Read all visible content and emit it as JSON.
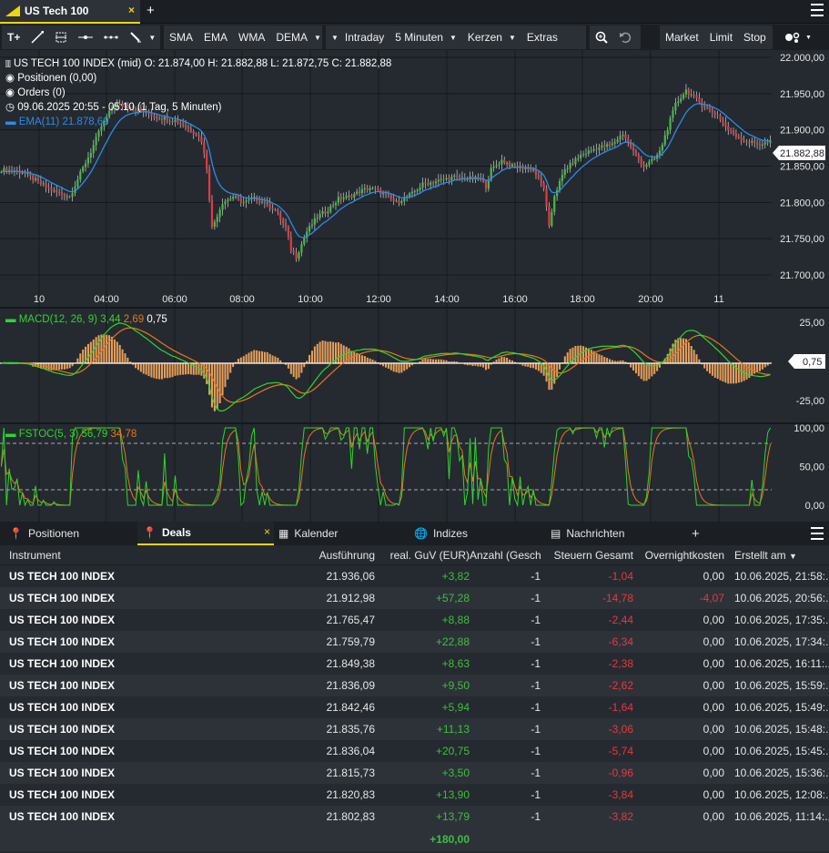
{
  "tab": {
    "title": "US Tech 100",
    "close": "×",
    "add": "+"
  },
  "toolbar": {
    "text_tool": "T+",
    "indicators": [
      "SMA",
      "EMA",
      "WMA",
      "DEMA"
    ],
    "period": "Intraday",
    "interval": "5 Minuten",
    "style": "Kerzen",
    "extras": "Extras",
    "orders": [
      "Market",
      "Limit",
      "Stop"
    ]
  },
  "chart_data": [
    {
      "type": "candlestick",
      "title": "US TECH 100 INDEX (mid)",
      "ohlc_label": "O: 21.874,00  H: 21.882,88  L: 21.872,75  C: 21.882,88",
      "legend": [
        "Positionen (0,00)",
        "Orders (0)",
        "09.06.2025 20:55 - 05:10  (1 Tag, 5 Minuten)"
      ],
      "ema_label": "EMA(11)",
      "ema_value": "21.878,69",
      "last_price": "21.882,88",
      "ylim": [
        21680,
        22010
      ],
      "y_ticks": [
        "22.000,00",
        "21.950,00",
        "21.900,00",
        "21.850,00",
        "21.800,00",
        "21.750,00",
        "21.700,00"
      ],
      "x_ticks": [
        "10",
        "04:00",
        "06:00",
        "08:00",
        "10:00",
        "12:00",
        "14:00",
        "16:00",
        "18:00",
        "20:00",
        "11"
      ],
      "close_path": [
        [
          0,
          21845
        ],
        [
          8,
          21842
        ],
        [
          14,
          21828
        ],
        [
          20,
          21815
        ],
        [
          26,
          21808
        ],
        [
          30,
          21840
        ],
        [
          34,
          21870
        ],
        [
          38,
          21905
        ],
        [
          42,
          21930
        ],
        [
          44,
          21935
        ],
        [
          48,
          21932
        ],
        [
          54,
          21925
        ],
        [
          60,
          21917
        ],
        [
          66,
          21913
        ],
        [
          70,
          21905
        ],
        [
          72,
          21900
        ],
        [
          74,
          21895
        ],
        [
          76,
          21885
        ],
        [
          78,
          21848
        ],
        [
          80,
          21765
        ],
        [
          84,
          21800
        ],
        [
          88,
          21808
        ],
        [
          92,
          21800
        ],
        [
          96,
          21805
        ],
        [
          100,
          21800
        ],
        [
          104,
          21790
        ],
        [
          108,
          21765
        ],
        [
          110,
          21735
        ],
        [
          112,
          21725
        ],
        [
          116,
          21760
        ],
        [
          120,
          21780
        ],
        [
          124,
          21790
        ],
        [
          128,
          21805
        ],
        [
          132,
          21808
        ],
        [
          136,
          21815
        ],
        [
          140,
          21820
        ],
        [
          144,
          21814
        ],
        [
          150,
          21800
        ],
        [
          156,
          21812
        ],
        [
          160,
          21825
        ],
        [
          166,
          21830
        ],
        [
          172,
          21835
        ],
        [
          178,
          21833
        ],
        [
          182,
          21832
        ],
        [
          184,
          21822
        ],
        [
          186,
          21845
        ],
        [
          190,
          21858
        ],
        [
          194,
          21850
        ],
        [
          198,
          21848
        ],
        [
          202,
          21845
        ],
        [
          206,
          21820
        ],
        [
          208,
          21765
        ],
        [
          210,
          21810
        ],
        [
          214,
          21845
        ],
        [
          220,
          21865
        ],
        [
          226,
          21875
        ],
        [
          232,
          21880
        ],
        [
          236,
          21895
        ],
        [
          240,
          21870
        ],
        [
          244,
          21850
        ],
        [
          248,
          21860
        ],
        [
          250,
          21870
        ],
        [
          256,
          21935
        ],
        [
          260,
          21955
        ],
        [
          266,
          21935
        ],
        [
          272,
          21920
        ],
        [
          276,
          21900
        ],
        [
          282,
          21885
        ],
        [
          288,
          21880
        ],
        [
          292,
          21883
        ]
      ]
    },
    {
      "type": "line",
      "title": "MACD(12, 26, 9)",
      "values": [
        "3,44",
        "2,69",
        "0,75"
      ],
      "last_value": "0,75",
      "y_ticks": [
        "25,00",
        "-25,00"
      ]
    },
    {
      "type": "line",
      "title": "FSTOC(5, 3)",
      "values": [
        "56,79",
        "34,78"
      ],
      "y_ticks": [
        "100,00",
        "50,00",
        "0,00"
      ]
    }
  ],
  "colors": {
    "bull": "#3fbf3f",
    "bear": "#e8383d",
    "ema": "#2b8be8",
    "macd": "#2ed62e",
    "signal": "#e8771a",
    "accent": "#f2d20a"
  },
  "panel": {
    "tabs": [
      {
        "label": "Positionen",
        "icon": "pin-icon"
      },
      {
        "label": "Deals",
        "icon": "pin-icon"
      },
      {
        "label": "Kalender",
        "icon": "calendar-icon"
      },
      {
        "label": "Indizes",
        "icon": "globe-icon"
      },
      {
        "label": "Nachrichten",
        "icon": "news-icon"
      }
    ],
    "deals_close": "×",
    "add": "+"
  },
  "table": {
    "headers": [
      "Instrument",
      "Ausführung",
      "real. GuV (EUR)",
      "Anzahl (Geschl",
      "Steuern Gesamt",
      "Overnightkosten",
      "Erstellt am"
    ],
    "sort_mark": "▼",
    "rows": [
      [
        "US TECH 100 INDEX",
        "21.936,06",
        "+3,82",
        "-1",
        "-1,04",
        "0,00",
        "10.06.2025, 21:58:..."
      ],
      [
        "US TECH 100 INDEX",
        "21.912,98",
        "+57,28",
        "-1",
        "-14,78",
        "-4,07",
        "10.06.2025, 20:56:..."
      ],
      [
        "US TECH 100 INDEX",
        "21.765,47",
        "+8,88",
        "-1",
        "-2,44",
        "0,00",
        "10.06.2025, 17:35:..."
      ],
      [
        "US TECH 100 INDEX",
        "21.759,79",
        "+22,88",
        "-1",
        "-6,34",
        "0,00",
        "10.06.2025, 17:34:..."
      ],
      [
        "US TECH 100 INDEX",
        "21.849,38",
        "+8,63",
        "-1",
        "-2,38",
        "0,00",
        "10.06.2025, 16:11:..."
      ],
      [
        "US TECH 100 INDEX",
        "21.836,09",
        "+9,50",
        "-1",
        "-2,62",
        "0,00",
        "10.06.2025, 15:59:..."
      ],
      [
        "US TECH 100 INDEX",
        "21.842,46",
        "+5,94",
        "-1",
        "-1,64",
        "0,00",
        "10.06.2025, 15:49:..."
      ],
      [
        "US TECH 100 INDEX",
        "21.835,76",
        "+11,13",
        "-1",
        "-3,06",
        "0,00",
        "10.06.2025, 15:48:..."
      ],
      [
        "US TECH 100 INDEX",
        "21.836,04",
        "+20,75",
        "-1",
        "-5,74",
        "0,00",
        "10.06.2025, 15:45:..."
      ],
      [
        "US TECH 100 INDEX",
        "21.815,73",
        "+3,50",
        "-1",
        "-0,96",
        "0,00",
        "10.06.2025, 15:36:..."
      ],
      [
        "US TECH 100 INDEX",
        "21.820,83",
        "+13,90",
        "-1",
        "-3,84",
        "0,00",
        "10.06.2025, 12:08:..."
      ],
      [
        "US TECH 100 INDEX",
        "21.802,83",
        "+13,79",
        "-1",
        "-3,82",
        "0,00",
        "10.06.2025, 11:14:..."
      ]
    ],
    "total": "+180,00"
  }
}
